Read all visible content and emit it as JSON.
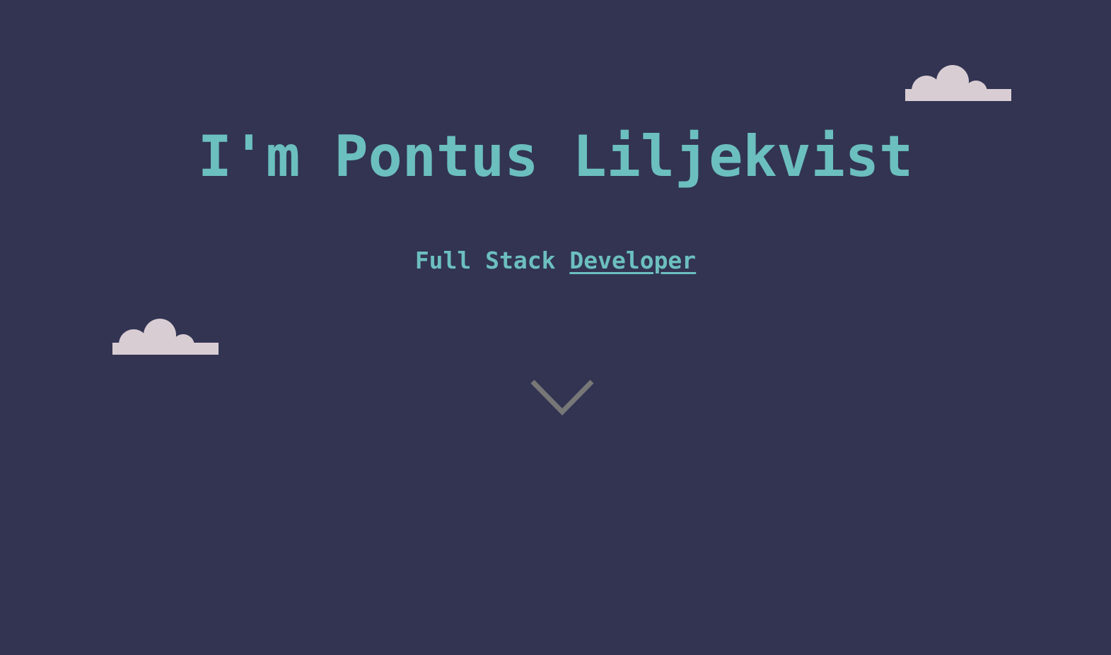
{
  "hero": {
    "title": "I'm Pontus Liljekvist",
    "subtitle_prefix": "Full Stack ",
    "subtitle_link": "Developer"
  },
  "icons": {
    "clouds": [
      "cloud-icon",
      "cloud-icon"
    ],
    "scroll": "chevron-down-icon"
  },
  "colors": {
    "background": "#323452",
    "accent": "#6cbfbf",
    "cloud": "#d9cdd4",
    "chevron": "#777777"
  }
}
